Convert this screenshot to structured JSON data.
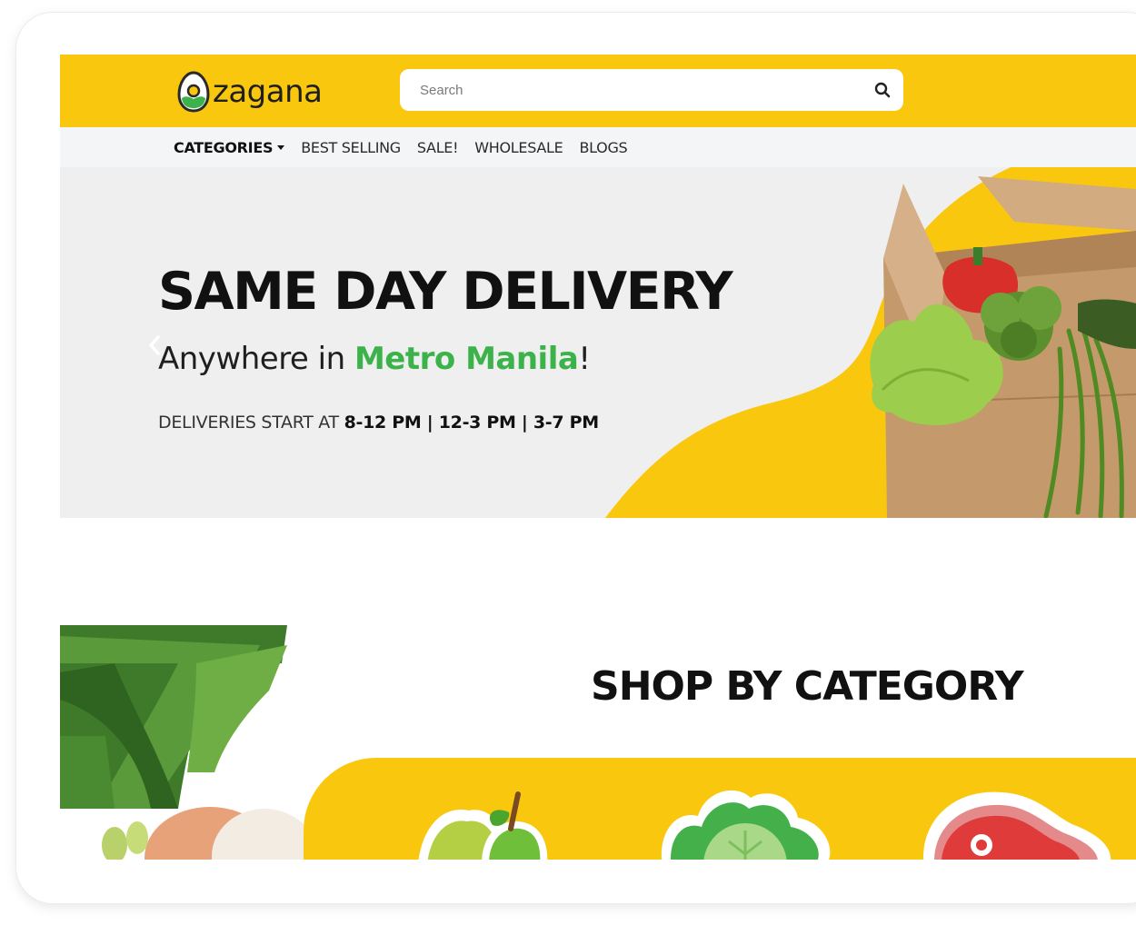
{
  "brand": {
    "logo_text": "zagana"
  },
  "search": {
    "placeholder": "Search"
  },
  "nav": {
    "categories": "CATEGORIES",
    "best_selling": "BEST SELLING",
    "sale": "SALE!",
    "wholesale": "WHOLESALE",
    "blogs": "BLOGS"
  },
  "hero": {
    "title": "SAME DAY DELIVERY",
    "subtitle_prefix": "Anywhere in ",
    "subtitle_highlight": "Metro Manila",
    "subtitle_suffix": "!",
    "times_prefix": "DELIVERIES START AT ",
    "times_hours": "8-12 PM | 12-3 PM | 3-7 PM"
  },
  "categories_section": {
    "title": "SHOP BY CATEGORY",
    "icons": [
      "fruit-icon",
      "vegetable-icon",
      "meat-icon"
    ]
  },
  "colors": {
    "brand_yellow": "#f9c80e",
    "accent_green": "#3cb34a",
    "hero_background": "#efefef",
    "nav_background": "#f4f5f6"
  }
}
